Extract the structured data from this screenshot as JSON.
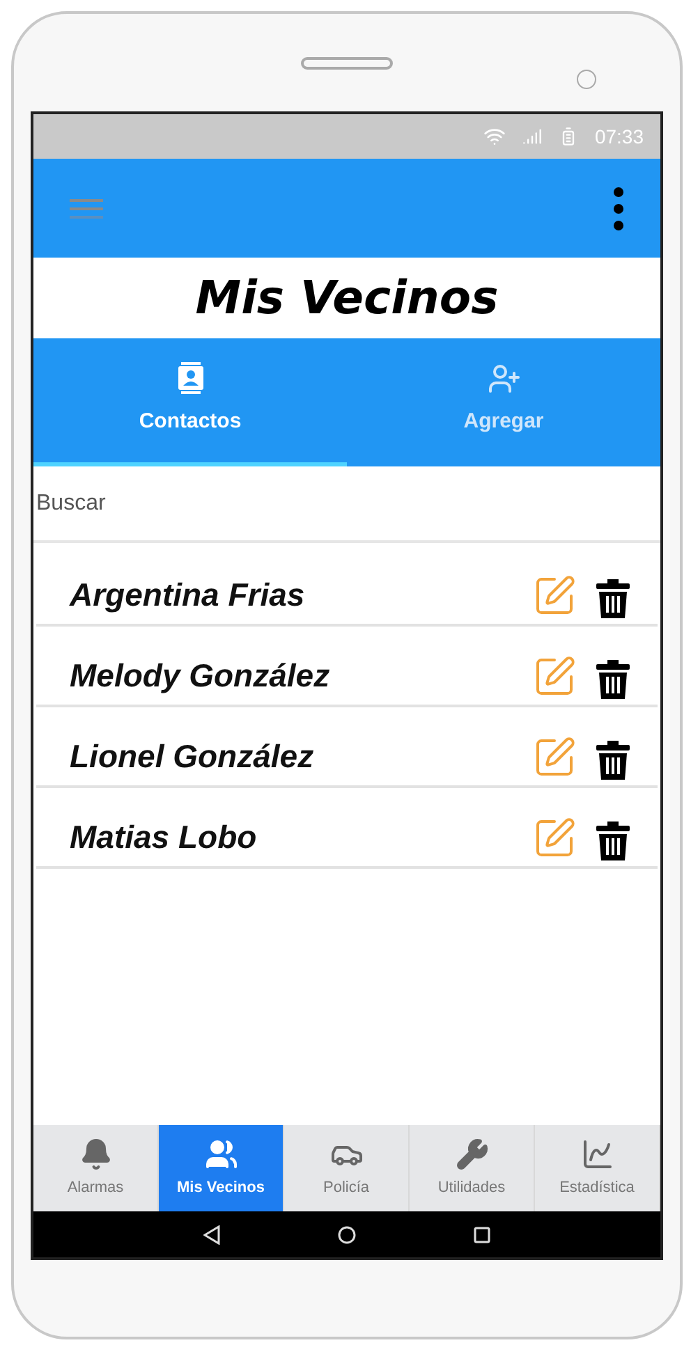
{
  "status_bar": {
    "time": "07:33"
  },
  "header": {
    "title": "Mis Vecinos"
  },
  "tabs": [
    {
      "label": "Contactos",
      "kind": "contacts",
      "selected": true
    },
    {
      "label": "Agregar",
      "kind": "add",
      "selected": false
    }
  ],
  "search": {
    "placeholder": "Buscar"
  },
  "contacts": [
    {
      "name": "Argentina Frias"
    },
    {
      "name": "Melody González"
    },
    {
      "name": "Lionel González"
    },
    {
      "name": "Matias Lobo"
    }
  ],
  "bottom_nav": [
    {
      "label": "Alarmas",
      "kind": "bell",
      "selected": false
    },
    {
      "label": "Mis Vecinos",
      "kind": "group",
      "selected": true
    },
    {
      "label": "Policía",
      "kind": "car",
      "selected": false
    },
    {
      "label": "Utilidades",
      "kind": "wrench",
      "selected": false
    },
    {
      "label": "Estadística",
      "kind": "chart",
      "selected": false
    }
  ]
}
